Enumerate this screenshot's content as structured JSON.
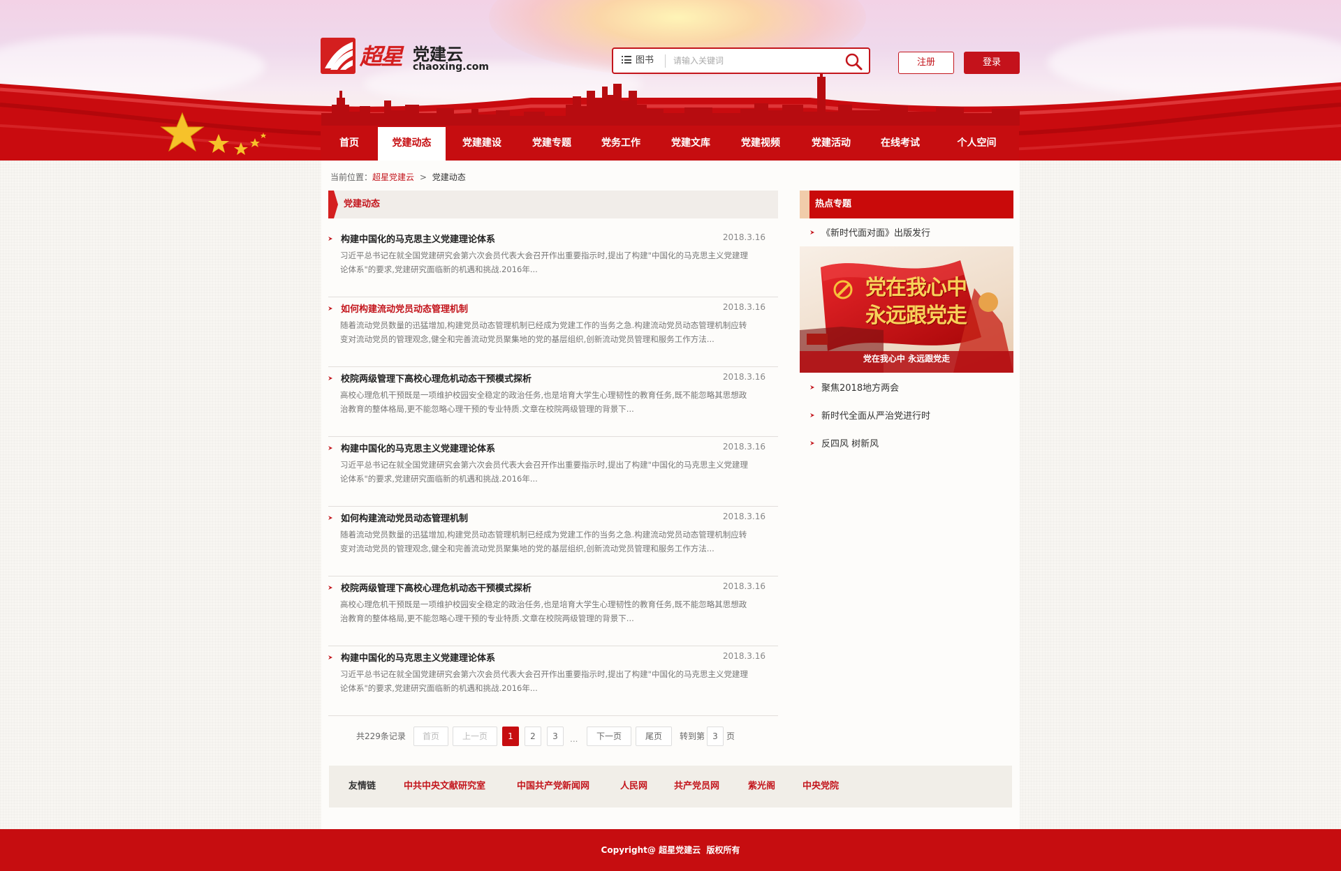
{
  "header": {
    "logo_cn": "超星",
    "logo_title": "党建云",
    "logo_domain": "chaoxing.com",
    "search": {
      "category": "图书",
      "placeholder": "请输入关键词"
    },
    "register_label": "注册",
    "login_label": "登录"
  },
  "nav": {
    "items": [
      "首页",
      "党建动态",
      "党建建设",
      "党建专题",
      "党务工作",
      "党建文库",
      "党建视频",
      "党建活动",
      "在线考试",
      "个人空间"
    ],
    "active_index": 1
  },
  "breadcrumb": {
    "prefix": "当前位置：",
    "home": "超星党建云",
    "sep": ">",
    "current": "党建动态"
  },
  "main": {
    "section_title": "党建动态",
    "articles": [
      {
        "title": "构建中国化的马克思主义党建理论体系",
        "date": "2018.3.16",
        "highlight": false,
        "summary_line1": "习近平总书记在就全国党建研究会第六次会员代表大会召开作出重要指示时,提出了构建\"中国化的马克思主义党建理",
        "summary_line2": "论体系\"的要求,党建研究面临新的机遇和挑战.2016年..."
      },
      {
        "title": "如何构建流动党员动态管理机制",
        "date": "2018.3.16",
        "highlight": true,
        "summary_line1": "随着流动党员数量的迅猛增加,构建党员动态管理机制已经成为党建工作的当务之急.构建流动党员动态管理机制应转",
        "summary_line2": "变对流动党员的管理观念,健全和完善流动党员聚集地的党的基层组织,创新流动党员管理和服务工作方法..."
      },
      {
        "title": "校院两级管理下高校心理危机动态干预模式探析",
        "date": "2018.3.16",
        "highlight": false,
        "summary_line1": "高校心理危机干预既是一项维护校园安全稳定的政治任务,也是培育大学生心理韧性的教育任务,既不能忽略其思想政",
        "summary_line2": "治教育的整体格局,更不能忽略心理干预的专业特质.文章在校院两级管理的背景下..."
      },
      {
        "title": "构建中国化的马克思主义党建理论体系",
        "date": "2018.3.16",
        "highlight": false,
        "summary_line1": "习近平总书记在就全国党建研究会第六次会员代表大会召开作出重要指示时,提出了构建\"中国化的马克思主义党建理",
        "summary_line2": "论体系\"的要求,党建研究面临新的机遇和挑战.2016年..."
      },
      {
        "title": "如何构建流动党员动态管理机制",
        "date": "2018.3.16",
        "highlight": false,
        "summary_line1": "随着流动党员数量的迅猛增加,构建党员动态管理机制已经成为党建工作的当务之急.构建流动党员动态管理机制应转",
        "summary_line2": "变对流动党员的管理观念,健全和完善流动党员聚集地的党的基层组织,创新流动党员管理和服务工作方法..."
      },
      {
        "title": "校院两级管理下高校心理危机动态干预模式探析",
        "date": "2018.3.16",
        "highlight": false,
        "summary_line1": "高校心理危机干预既是一项维护校园安全稳定的政治任务,也是培育大学生心理韧性的教育任务,既不能忽略其思想政",
        "summary_line2": "治教育的整体格局,更不能忽略心理干预的专业特质.文章在校院两级管理的背景下..."
      },
      {
        "title": "构建中国化的马克思主义党建理论体系",
        "date": "2018.3.16",
        "highlight": false,
        "summary_line1": "习近平总书记在就全国党建研究会第六次会员代表大会召开作出重要指示时,提出了构建\"中国化的马克思主义党建理",
        "summary_line2": "论体系\"的要求,党建研究面临新的机遇和挑战.2016年..."
      }
    ]
  },
  "pagination": {
    "total": "共229条记录",
    "first": "首页",
    "prev": "上一页",
    "pages": [
      "1",
      "2",
      "3"
    ],
    "current": "1",
    "ellipsis": "...",
    "next": "下一页",
    "last": "尾页",
    "goto_prefix": "转到第",
    "goto_value": "3",
    "goto_suffix": "页"
  },
  "sidebar": {
    "title": "热点专题",
    "top_item": "《新时代面对面》出版发行",
    "banner_text_line1": "党在我心中",
    "banner_text_line2": "永远跟党走",
    "banner_caption": "党在我心中 永远跟党走",
    "items": [
      "聚焦2018地方两会",
      "新时代全面从严治党进行时",
      "反四风 树新风"
    ]
  },
  "friend_links": {
    "label": "友情链",
    "links": [
      "中共中央文献研究室",
      "中国共产党新闻网",
      "人民网",
      "共产党员网",
      "紫光阁",
      "中央党院"
    ]
  },
  "footer": {
    "copyright": "Copyright@ 超星党建云  版权所有"
  },
  "colors": {
    "primary_red": "#c60d10",
    "link_red": "#c3151c",
    "background": "#f8f6f2"
  }
}
